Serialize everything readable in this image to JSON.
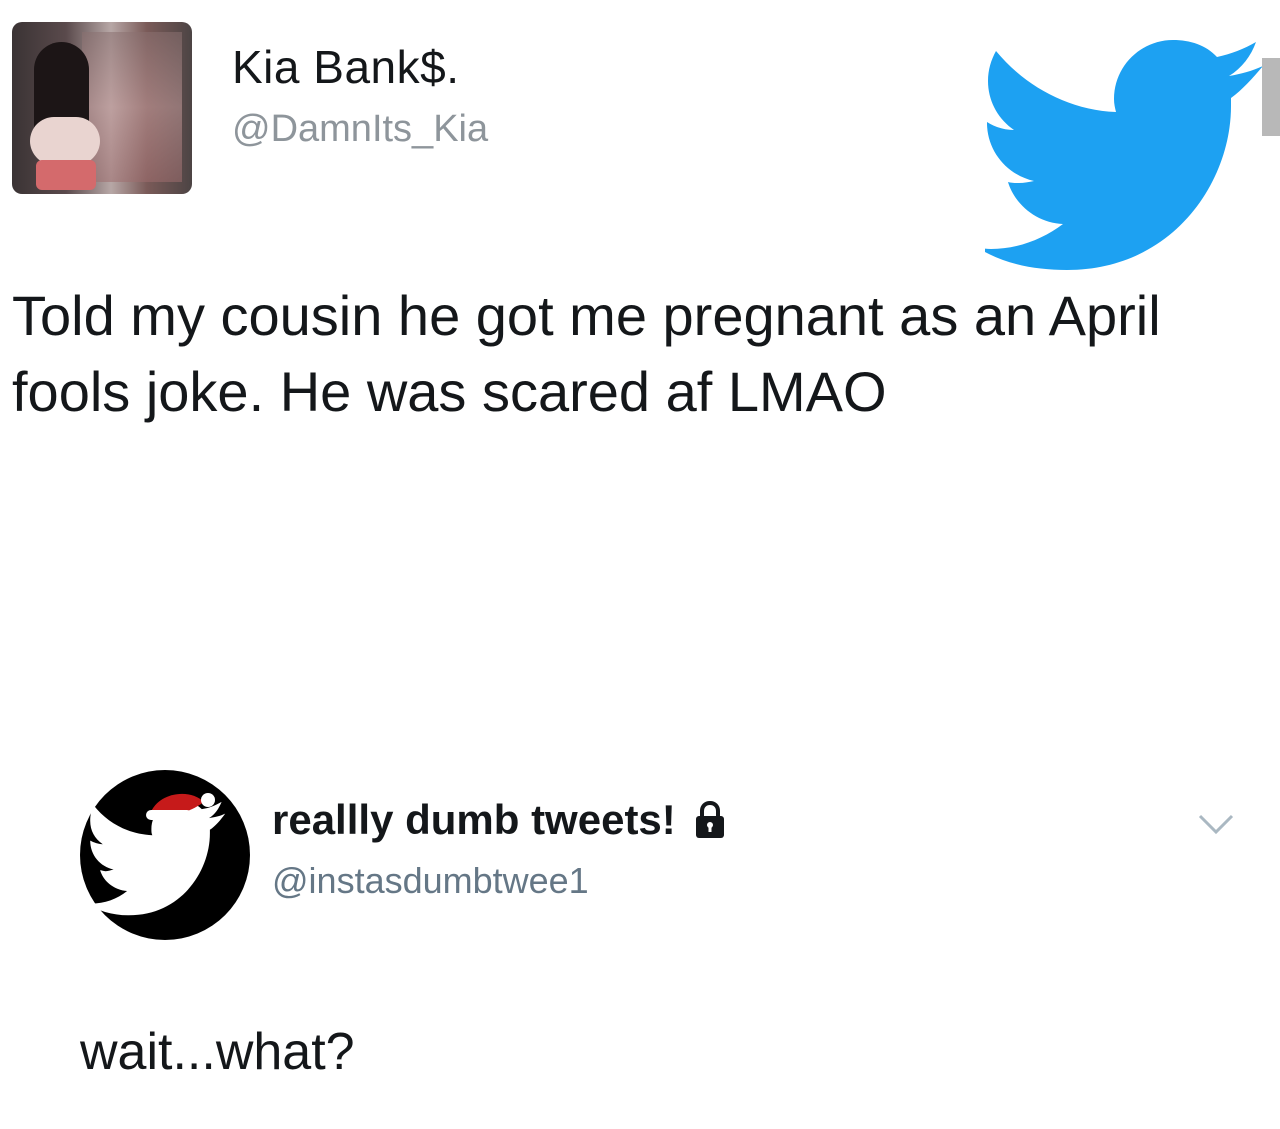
{
  "tweet_1": {
    "display_name": "Kia Bank$.",
    "handle": "@DamnIts_Kia",
    "text": "Told my cousin he got me pregnant as an April fools joke. He was scared af LMAO",
    "logo_icon": "twitter-bird-icon",
    "logo_color": "#1da1f2"
  },
  "tweet_2": {
    "display_name": "reallly dumb tweets!",
    "handle": "@instasdumbtwee1",
    "text": "wait...what?",
    "locked_icon": "lock-icon",
    "menu_icon": "chevron-down-icon",
    "avatar_icon": "santa-twitter-bird-icon"
  },
  "colors": {
    "text_primary": "#14171a",
    "text_secondary": "#8e959b",
    "twitter_blue": "#1da1f2"
  }
}
